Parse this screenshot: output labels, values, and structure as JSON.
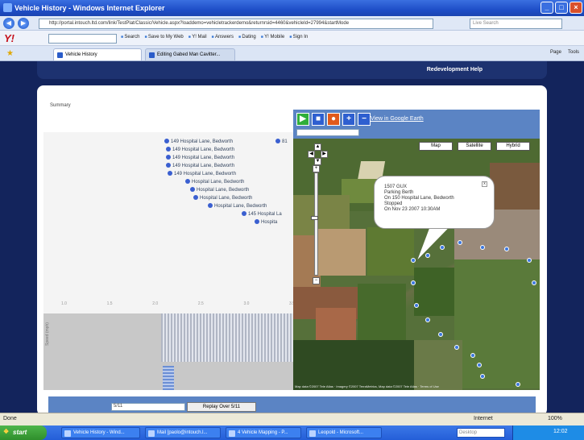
{
  "window": {
    "title": "Vehicle History - Windows Internet Explorer",
    "controls": [
      "_",
      "□",
      "×"
    ]
  },
  "addressbar": {
    "back": "◀",
    "forward": "▶",
    "url": "http://portal.intouch.ltd.com/link/TestPlat/Classic/Vehicle.aspx?loaddemo=vehicletrackerdemo&returnrsid=4460&vehicleId=27994&startMode",
    "search_placeholder": "Live Search"
  },
  "yahoo_toolbar": {
    "logo": "Y!",
    "items": [
      "Search",
      "Save to My Web",
      "Y! Mail",
      "Answers",
      "Dating",
      "Y! Mobile",
      "Sign In"
    ]
  },
  "tabs": [
    {
      "label": "Vehicle History",
      "active": true
    },
    {
      "label": "Editing Gabed Man Cavitter...",
      "active": false
    }
  ],
  "commandbar": [
    "Page",
    "Tools"
  ],
  "site": {
    "header_link": "Redevelopment Help",
    "summary": "Summary"
  },
  "chart": {
    "locations": [
      "149 Hospital Lane, Bedworth",
      "149 Hospital Lane, Bedworth",
      "149 Hospital Lane, Bedworth",
      "149 Hospital Lane, Bedworth",
      "149 Hospital Lane, Bedworth",
      "Hospital Lane, Bedworth",
      "Hospital Lane, Bedworth",
      "Hospital Lane, Bedworth",
      "Hospital Lane, Bedworth",
      "145 Hospital La",
      "Hospita",
      "81"
    ],
    "ticks": [
      "1.0",
      "1.5",
      "2.0",
      "2.5",
      "3.0",
      "3.5"
    ],
    "vertical_label": "Speed (mph)"
  },
  "map": {
    "google_earth_link": "View in Google Earth",
    "map_types": [
      "Map",
      "Satellite",
      "Hybrid"
    ],
    "zoom_in": "+",
    "zoom_out": "−",
    "pan": [
      "▲",
      "◀",
      "▶",
      "▼"
    ],
    "bubble_lines": [
      "1507 GUX",
      "Parking Berth",
      "On 150 Hospital Lane, Bedworth",
      "Stopped",
      "On Nov 23 2007 10:30AM"
    ],
    "bubble_close": "x",
    "copyright": "Map data ©2007 Tele Atlas · Imagery ©2007 TerraMetrics, Map data ©2007 Tele Atlas · Terms of Use"
  },
  "footer": {
    "input_value": "5/11",
    "button": "Replay Over 5/11"
  },
  "statusbar": {
    "left": "Done",
    "zone": "Internet",
    "zoom": "100%"
  },
  "taskbar": {
    "start": "start",
    "tasks": [
      "Vehicle History - Wind...",
      "Mail [paolo@intouch.l...",
      "4 Vehicle Mapping - P...",
      "Leopold - Microsoft..."
    ],
    "search_placeholder": "Desktop",
    "clock": "12:02"
  },
  "colors": {
    "page_bg": "#13245c",
    "map_panel": "#5b84c4",
    "track_point": "#3c78e0"
  }
}
